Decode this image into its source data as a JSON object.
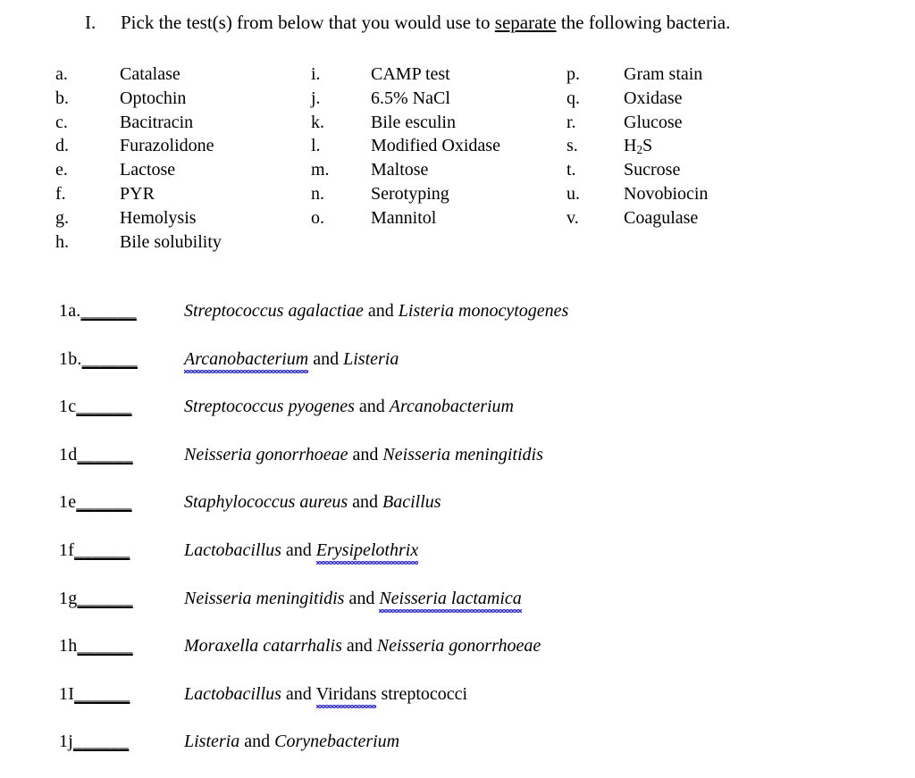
{
  "document": {
    "background_color": "#ffffff",
    "text_color": "#000000",
    "spellcheck_underline_color": "#3333cc"
  },
  "prompt": {
    "numeral": "I.",
    "before_underlined": "Pick the test(s) from below that you would use to ",
    "underlined_word": "separate",
    "after_underlined": " the following bacteria."
  },
  "test_columns": [
    {
      "name": "column-1",
      "entries": [
        {
          "letter": "a.",
          "label": "Catalase"
        },
        {
          "letter": "b.",
          "label": "Optochin"
        },
        {
          "letter": "c.",
          "label": "Bacitracin"
        },
        {
          "letter": "d.",
          "label": "Furazolidone"
        },
        {
          "letter": "e.",
          "label": "Lactose"
        },
        {
          "letter": "f.",
          "label": "PYR"
        },
        {
          "letter": "g.",
          "label": "Hemolysis"
        },
        {
          "letter": "h.",
          "label": "Bile solubility"
        }
      ]
    },
    {
      "name": "column-2",
      "entries": [
        {
          "letter": "i.",
          "label": "CAMP test"
        },
        {
          "letter": "j.",
          "label": "6.5% NaCl"
        },
        {
          "letter": "k.",
          "label": "Bile esculin"
        },
        {
          "letter": "l.",
          "label": "Modified Oxidase"
        },
        {
          "letter": "m.",
          "label": "Maltose"
        },
        {
          "letter": "n.",
          "label": "Serotyping"
        },
        {
          "letter": "o.",
          "label": "Mannitol"
        }
      ]
    },
    {
      "name": "column-3",
      "entries": [
        {
          "letter": "p.",
          "label": "Gram stain"
        },
        {
          "letter": "q.",
          "label": "Oxidase"
        },
        {
          "letter": "r.",
          "label": "Glucose"
        },
        {
          "letter": "s.",
          "label_html": "H2S",
          "sub_base": "H",
          "sub_script": "2",
          "sub_tail": "S"
        },
        {
          "letter": "t.",
          "label": "Sucrose"
        },
        {
          "letter": "u.",
          "label": "Novobiocin"
        },
        {
          "letter": "v.",
          "label": "Coagulase"
        }
      ]
    }
  ],
  "items": [
    {
      "key": "1a.",
      "blank": "______",
      "organism_1": "Streptococcus agalactiae",
      "conjunction": " and ",
      "organism_2": "Listeria monocytogenes",
      "misspelled": [],
      "trailing_plain": ""
    },
    {
      "key": "1b.",
      "blank": "______",
      "organism_1": "Arcanobacterium",
      "conjunction": " and ",
      "organism_2": "Listeria",
      "misspelled": [
        "organism_1"
      ],
      "trailing_plain": ""
    },
    {
      "key": "1c",
      "blank": "______",
      "organism_1": "Streptococcus pyogenes",
      "conjunction": " and ",
      "organism_2": "Arcanobacterium",
      "misspelled": [],
      "trailing_plain": ""
    },
    {
      "key": "1d",
      "blank": "______",
      "organism_1": "Neisseria gonorrhoeae",
      "conjunction": " and ",
      "organism_2": "Neisseria meningitidis",
      "misspelled": [],
      "trailing_plain": ""
    },
    {
      "key": "1e",
      "blank": "______",
      "organism_1": "Staphylococcus aureus",
      "conjunction": " and ",
      "organism_2": "Bacillus",
      "misspelled": [],
      "trailing_plain": ""
    },
    {
      "key": "1f",
      "blank": "______",
      "organism_1": "Lactobacillus",
      "conjunction": " and ",
      "organism_2": "Erysipelothrix",
      "misspelled": [
        "organism_2"
      ],
      "trailing_plain": ""
    },
    {
      "key": "1g",
      "blank": "______",
      "organism_1": "Neisseria meningitidis",
      "conjunction": " and ",
      "organism_2": "Neisseria lactamica",
      "misspelled": [
        "organism_2_partial"
      ],
      "trailing_plain": ""
    },
    {
      "key": "1h",
      "blank": "______",
      "organism_1": "Moraxella catarrhalis",
      "conjunction": " and ",
      "organism_2": "Neisseria gonorrhoeae",
      "misspelled": [],
      "trailing_plain": ""
    },
    {
      "key": "1I",
      "blank": "______",
      "organism_1": "Lactobacillus",
      "conjunction": " and ",
      "organism_2": "Viridans",
      "misspelled": [
        "organism_2"
      ],
      "trailing_plain": " streptococci"
    },
    {
      "key": "1j",
      "blank": "______",
      "organism_1": "Listeria",
      "conjunction": " and ",
      "organism_2": "Corynebacterium",
      "misspelled": [],
      "trailing_plain": ""
    }
  ]
}
